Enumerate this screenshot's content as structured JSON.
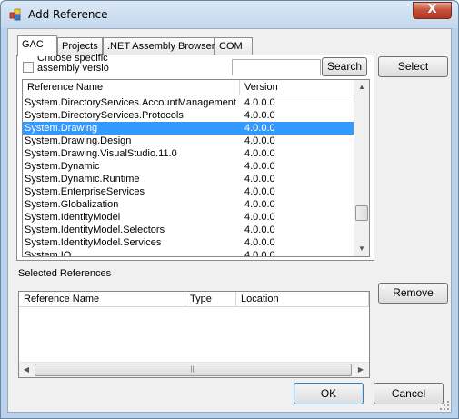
{
  "window": {
    "title": "Add Reference",
    "close_glyph": "X"
  },
  "tabs": [
    {
      "label": "GAC",
      "active": true
    },
    {
      "label": "Projects",
      "active": false
    },
    {
      "label": ".NET Assembly Browser",
      "active": false
    },
    {
      "label": "COM",
      "active": false
    }
  ],
  "gac": {
    "checkbox_label": "Choose specific assembly versio",
    "checkbox_checked": false,
    "search_value": "",
    "search_button": "Search",
    "columns": [
      "Reference Name",
      "Version"
    ],
    "rows": [
      {
        "name": "System.DirectoryServices.AccountManagement",
        "version": "4.0.0.0",
        "selected": false
      },
      {
        "name": "System.DirectoryServices.Protocols",
        "version": "4.0.0.0",
        "selected": false
      },
      {
        "name": "System.Drawing",
        "version": "4.0.0.0",
        "selected": true
      },
      {
        "name": "System.Drawing.Design",
        "version": "4.0.0.0",
        "selected": false
      },
      {
        "name": "System.Drawing.VisualStudio.11.0",
        "version": "4.0.0.0",
        "selected": false
      },
      {
        "name": "System.Dynamic",
        "version": "4.0.0.0",
        "selected": false
      },
      {
        "name": "System.Dynamic.Runtime",
        "version": "4.0.0.0",
        "selected": false
      },
      {
        "name": "System.EnterpriseServices",
        "version": "4.0.0.0",
        "selected": false
      },
      {
        "name": "System.Globalization",
        "version": "4.0.0.0",
        "selected": false
      },
      {
        "name": "System.IdentityModel",
        "version": "4.0.0.0",
        "selected": false
      },
      {
        "name": "System.IdentityModel.Selectors",
        "version": "4.0.0.0",
        "selected": false
      },
      {
        "name": "System.IdentityModel.Services",
        "version": "4.0.0.0",
        "selected": false
      },
      {
        "name": "System.IO",
        "version": "4.0.0.0",
        "selected": false
      }
    ]
  },
  "buttons": {
    "select": "Select",
    "remove": "Remove",
    "ok": "OK",
    "cancel": "Cancel"
  },
  "selected_references": {
    "label": "Selected References",
    "columns": [
      "Reference Name",
      "Type",
      "Location"
    ],
    "rows": []
  },
  "colors": {
    "selection": "#3399ff",
    "dialog_bg": "#f0f0f0",
    "titlebar": "#c4d8ee",
    "close_button": "#c4533d"
  },
  "icons": [
    "app-icon",
    "close-icon",
    "scroll-up-arrow-icon",
    "scroll-down-arrow-icon",
    "scroll-left-arrow-icon",
    "scroll-right-arrow-icon",
    "scroll-grip-icon",
    "size-grip-icon"
  ]
}
